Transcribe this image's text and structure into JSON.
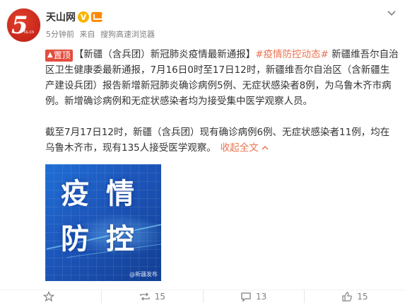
{
  "user": {
    "name": "天山网",
    "verified_mark": "V",
    "avatar_text": "5",
    "avatar_sub": "ts.cn"
  },
  "meta": {
    "time": "5分钟前",
    "source_prefix": "来自",
    "source": "搜狗高速浏览器"
  },
  "post": {
    "pin_label": "置顶",
    "title": "【新疆（含兵团）新冠肺炎疫情最新通报】",
    "hashtag": "#疫情防控动态#",
    "paragraph1": " 新疆维吾尔自治区卫生健康委最新通报，7月16日0时至17日12时，新疆维吾尔自治区（含新疆生产建设兵团）报告新增新冠肺炎确诊病例5例、无症状感染者8例，为乌鲁木齐市病例。新增确诊病例和无症状感染者均为接受集中医学观察人员。",
    "paragraph2": "截至7月17日12时，新疆（含兵团）现有确诊病例6例、无症状感染者11例，均在乌鲁木齐市，现有135人接受医学观察。",
    "collapse_label": "收起全文"
  },
  "image": {
    "char1": "疫",
    "char2": "情",
    "char3": "防",
    "char4": "控",
    "watermark": "@新疆发布"
  },
  "actions": {
    "favorite": "",
    "repost_count": "15",
    "comment_count": "13",
    "like_count": "15"
  },
  "colors": {
    "link": "#eb7350",
    "pin_bg": "#e34e3f",
    "verified": "#f7b500"
  }
}
